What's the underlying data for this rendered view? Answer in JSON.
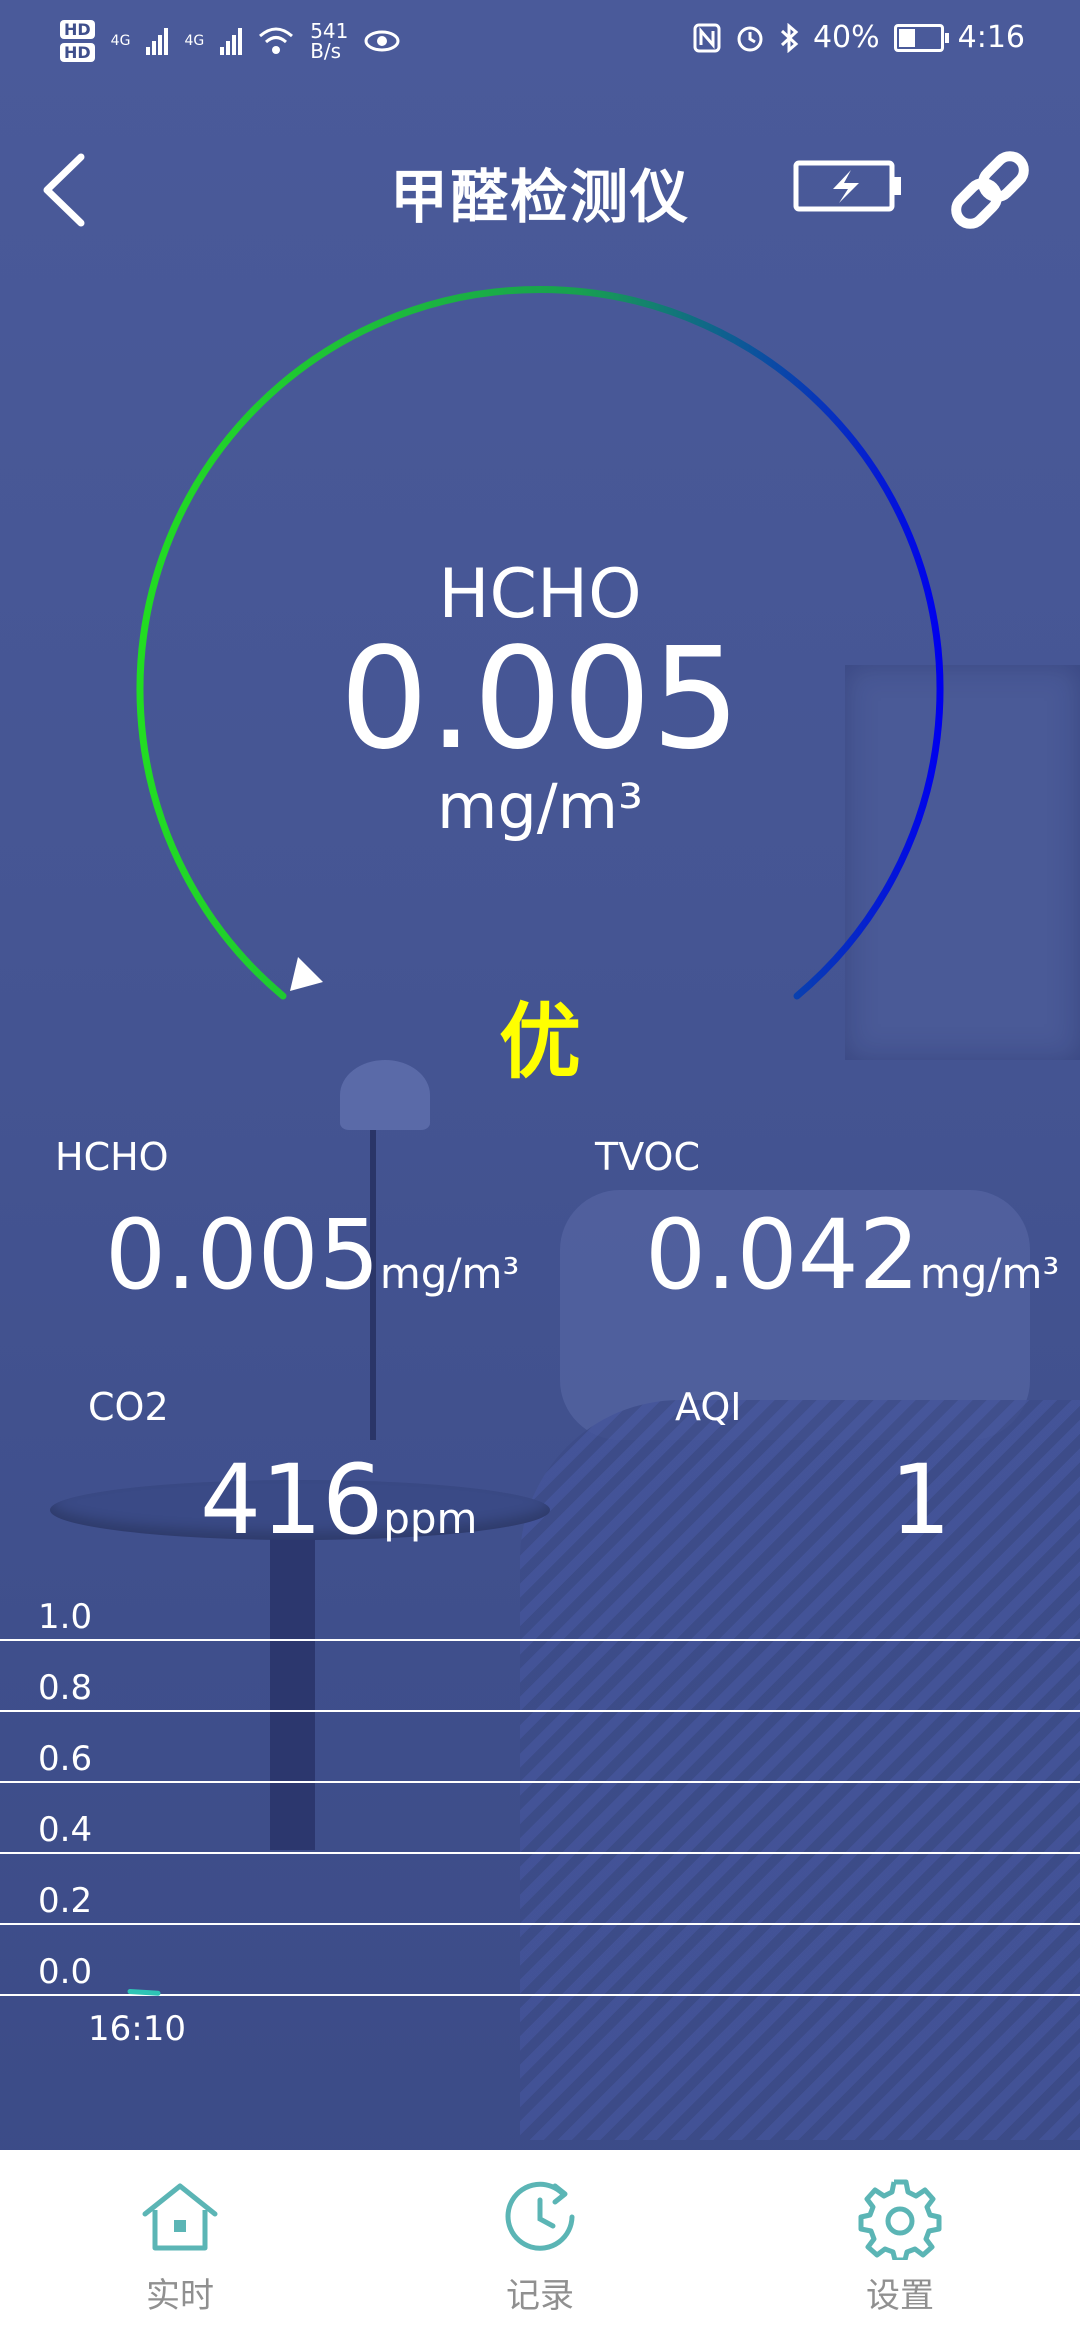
{
  "status_bar": {
    "hd1": "HD",
    "hd2": "HD",
    "sim1": "4G",
    "sim2": "4G",
    "net_speed_value": "541",
    "net_speed_unit": "B/s",
    "battery_pct": "40%",
    "time": "4:16"
  },
  "header": {
    "title": "甲醛检测仪"
  },
  "gauge": {
    "label": "HCHO",
    "value": "0.005",
    "unit": "mg/m³",
    "grade": "优",
    "arc_colors": [
      "#22dd22",
      "#0000ee"
    ],
    "grade_color": "#ffff00"
  },
  "readings": {
    "hcho": {
      "label": "HCHO",
      "value": "0.005",
      "unit": "mg/m³"
    },
    "tvoc": {
      "label": "TVOC",
      "value": "0.042",
      "unit": "mg/m³"
    },
    "co2": {
      "label": "CO2",
      "value": "416",
      "unit": "ppm"
    },
    "aqi": {
      "label": "AQI",
      "value": "1"
    }
  },
  "chart_data": {
    "type": "line",
    "ylim": [
      0.0,
      1.0
    ],
    "y_ticks": [
      "1.0",
      "0.8",
      "0.6",
      "0.4",
      "0.2",
      "0.0"
    ],
    "x_ticks": [
      "16:10"
    ],
    "grid": true,
    "series": [
      {
        "color": "#2ec4b6",
        "points": [
          [
            0,
            0.01
          ],
          [
            1,
            0.005
          ]
        ]
      }
    ]
  },
  "nav": {
    "items": [
      {
        "label": "实时",
        "icon": "home-icon"
      },
      {
        "label": "记录",
        "icon": "history-icon"
      },
      {
        "label": "设置",
        "icon": "settings-icon"
      }
    ],
    "color": "#5bb5b5"
  }
}
